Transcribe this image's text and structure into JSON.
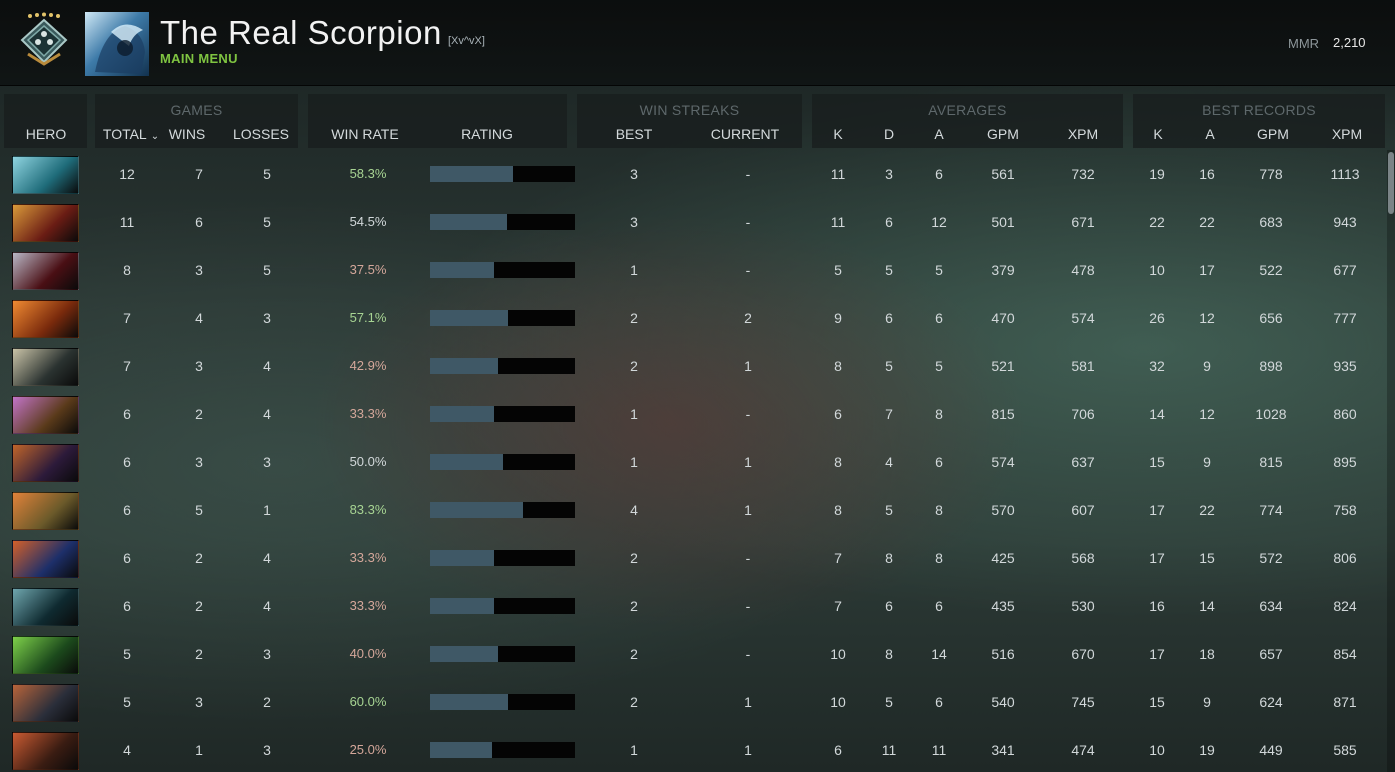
{
  "header": {
    "player_name": "The Real Scorpion",
    "clan_tag": "[Xv^vX]",
    "nav_label": "MAIN MENU",
    "mmr_label": "MMR",
    "mmr_value": "2,210",
    "rank_icon": "rank-medal-icon",
    "avatar_icon": "player-avatar"
  },
  "groups": {
    "games": "GAMES",
    "win_streaks": "WIN STREAKS",
    "averages": "AVERAGES",
    "best_records": "BEST RECORDS"
  },
  "columns": {
    "hero": "HERO",
    "total": "TOTAL",
    "wins": "WINS",
    "losses": "LOSSES",
    "win_rate": "WIN RATE",
    "rating": "RATING",
    "best": "BEST",
    "current": "CURRENT",
    "avg_k": "K",
    "avg_d": "D",
    "avg_a": "A",
    "avg_gpm": "GPM",
    "avg_xpm": "XPM",
    "best_k": "K",
    "best_a": "A",
    "best_gpm": "GPM",
    "best_xpm": "XPM"
  },
  "colors": {
    "accent_green": "#7fc441",
    "win_high": "#a7d493",
    "win_low": "#d4a79a",
    "win_neutral": "#d2d8da",
    "rating_fill": "#3f5866"
  },
  "rows": [
    {
      "hero_colors": [
        "#1f6c7a",
        "#8fd4e0"
      ],
      "total": "12",
      "wins": "7",
      "losses": "5",
      "win_rate": "58.3%",
      "rating": 0.57,
      "best": "3",
      "current": "-",
      "k": "11",
      "d": "3",
      "a": "6",
      "gpm": "561",
      "xpm": "732",
      "bk": "19",
      "ba": "16",
      "bgpm": "778",
      "bxpm": "1113"
    },
    {
      "hero_colors": [
        "#6a1c14",
        "#d99a3a"
      ],
      "total": "11",
      "wins": "6",
      "losses": "5",
      "win_rate": "54.5%",
      "rating": 0.53,
      "best": "3",
      "current": "-",
      "k": "11",
      "d": "6",
      "a": "12",
      "gpm": "501",
      "xpm": "671",
      "bk": "22",
      "ba": "22",
      "bgpm": "683",
      "bxpm": "943"
    },
    {
      "hero_colors": [
        "#4a0f14",
        "#b9b7c6"
      ],
      "total": "8",
      "wins": "3",
      "losses": "5",
      "win_rate": "37.5%",
      "rating": 0.44,
      "best": "1",
      "current": "-",
      "k": "5",
      "d": "5",
      "a": "5",
      "gpm": "379",
      "xpm": "478",
      "bk": "10",
      "ba": "17",
      "bgpm": "522",
      "bxpm": "677"
    },
    {
      "hero_colors": [
        "#7a2a0c",
        "#f08a32"
      ],
      "total": "7",
      "wins": "4",
      "losses": "3",
      "win_rate": "57.1%",
      "rating": 0.54,
      "best": "2",
      "current": "2",
      "k": "9",
      "d": "6",
      "a": "6",
      "gpm": "470",
      "xpm": "574",
      "bk": "26",
      "ba": "12",
      "bgpm": "656",
      "bxpm": "777"
    },
    {
      "hero_colors": [
        "#2a3230",
        "#c9c3a7"
      ],
      "total": "7",
      "wins": "3",
      "losses": "4",
      "win_rate": "42.9%",
      "rating": 0.47,
      "best": "2",
      "current": "1",
      "k": "8",
      "d": "5",
      "a": "5",
      "gpm": "521",
      "xpm": "581",
      "bk": "32",
      "ba": "9",
      "bgpm": "898",
      "bxpm": "935"
    },
    {
      "hero_colors": [
        "#5a3a1a",
        "#c274c8"
      ],
      "total": "6",
      "wins": "2",
      "losses": "4",
      "win_rate": "33.3%",
      "rating": 0.44,
      "best": "1",
      "current": "-",
      "k": "6",
      "d": "7",
      "a": "8",
      "gpm": "815",
      "xpm": "706",
      "bk": "14",
      "ba": "12",
      "bgpm": "1028",
      "bxpm": "860"
    },
    {
      "hero_colors": [
        "#2c1a3a",
        "#c0652a"
      ],
      "total": "6",
      "wins": "3",
      "losses": "3",
      "win_rate": "50.0%",
      "rating": 0.5,
      "best": "1",
      "current": "1",
      "k": "8",
      "d": "4",
      "a": "6",
      "gpm": "574",
      "xpm": "637",
      "bk": "15",
      "ba": "9",
      "bgpm": "815",
      "bxpm": "895"
    },
    {
      "hero_colors": [
        "#6b5a2a",
        "#e1823a"
      ],
      "total": "6",
      "wins": "5",
      "losses": "1",
      "win_rate": "83.3%",
      "rating": 0.64,
      "best": "4",
      "current": "1",
      "k": "8",
      "d": "5",
      "a": "8",
      "gpm": "570",
      "xpm": "607",
      "bk": "17",
      "ba": "22",
      "bgpm": "774",
      "bxpm": "758"
    },
    {
      "hero_colors": [
        "#1d2f6a",
        "#d3602a"
      ],
      "total": "6",
      "wins": "2",
      "losses": "4",
      "win_rate": "33.3%",
      "rating": 0.44,
      "best": "2",
      "current": "-",
      "k": "7",
      "d": "8",
      "a": "8",
      "gpm": "425",
      "xpm": "568",
      "bk": "17",
      "ba": "15",
      "bgpm": "572",
      "bxpm": "806"
    },
    {
      "hero_colors": [
        "#0f2a30",
        "#6fa6ae"
      ],
      "total": "6",
      "wins": "2",
      "losses": "4",
      "win_rate": "33.3%",
      "rating": 0.44,
      "best": "2",
      "current": "-",
      "k": "7",
      "d": "6",
      "a": "6",
      "gpm": "435",
      "xpm": "530",
      "bk": "16",
      "ba": "14",
      "bgpm": "634",
      "bxpm": "824"
    },
    {
      "hero_colors": [
        "#1c4a1c",
        "#7ed14a"
      ],
      "total": "5",
      "wins": "2",
      "losses": "3",
      "win_rate": "40.0%",
      "rating": 0.47,
      "best": "2",
      "current": "-",
      "k": "10",
      "d": "8",
      "a": "14",
      "gpm": "516",
      "xpm": "670",
      "bk": "17",
      "ba": "18",
      "bgpm": "657",
      "bxpm": "854"
    },
    {
      "hero_colors": [
        "#2a2e3a",
        "#b8643a"
      ],
      "total": "5",
      "wins": "3",
      "losses": "2",
      "win_rate": "60.0%",
      "rating": 0.54,
      "best": "2",
      "current": "1",
      "k": "10",
      "d": "5",
      "a": "6",
      "gpm": "540",
      "xpm": "745",
      "bk": "15",
      "ba": "9",
      "bgpm": "624",
      "bxpm": "871"
    },
    {
      "hero_colors": [
        "#3a1c12",
        "#c85a32"
      ],
      "total": "4",
      "wins": "1",
      "losses": "3",
      "win_rate": "25.0%",
      "rating": 0.43,
      "best": "1",
      "current": "1",
      "k": "6",
      "d": "11",
      "a": "11",
      "gpm": "341",
      "xpm": "474",
      "bk": "10",
      "ba": "19",
      "bgpm": "449",
      "bxpm": "585"
    }
  ]
}
